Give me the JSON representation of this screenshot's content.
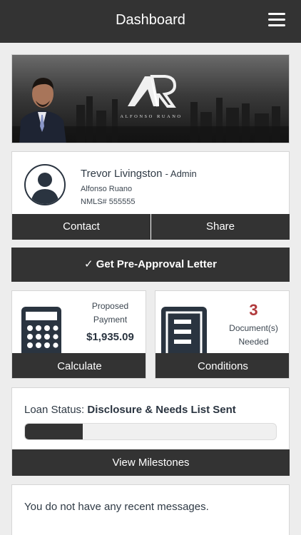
{
  "header": {
    "title": "Dashboard",
    "menu_icon": "hamburger-menu-icon"
  },
  "banner": {
    "logo_text": "AR",
    "tagline": "ALFONSO RUANO"
  },
  "profile": {
    "name": "Trevor Livingston",
    "role": "- Admin",
    "company": "Alfonso Ruano",
    "nmls": "NMLS# 555555",
    "contact_label": "Contact",
    "share_label": "Share"
  },
  "preapproval": {
    "label": "✓ Get Pre-Approval Letter"
  },
  "payment": {
    "label_line1": "Proposed",
    "label_line2": "Payment",
    "amount": "$1,935.09",
    "button": "Calculate",
    "icon": "calculator-icon"
  },
  "conditions": {
    "count": "3",
    "label_line1": "Document(s)",
    "label_line2": "Needed",
    "button": "Conditions",
    "icon": "document-list-icon"
  },
  "loan_status": {
    "label": "Loan Status:",
    "value": "Disclosure & Needs List Sent",
    "progress_percent": 23,
    "button": "View Milestones"
  },
  "messages": {
    "empty_text": "You do not have any recent messages."
  },
  "colors": {
    "dark": "#333333",
    "accent_red": "#b0393b",
    "navy": "#2a3440"
  }
}
